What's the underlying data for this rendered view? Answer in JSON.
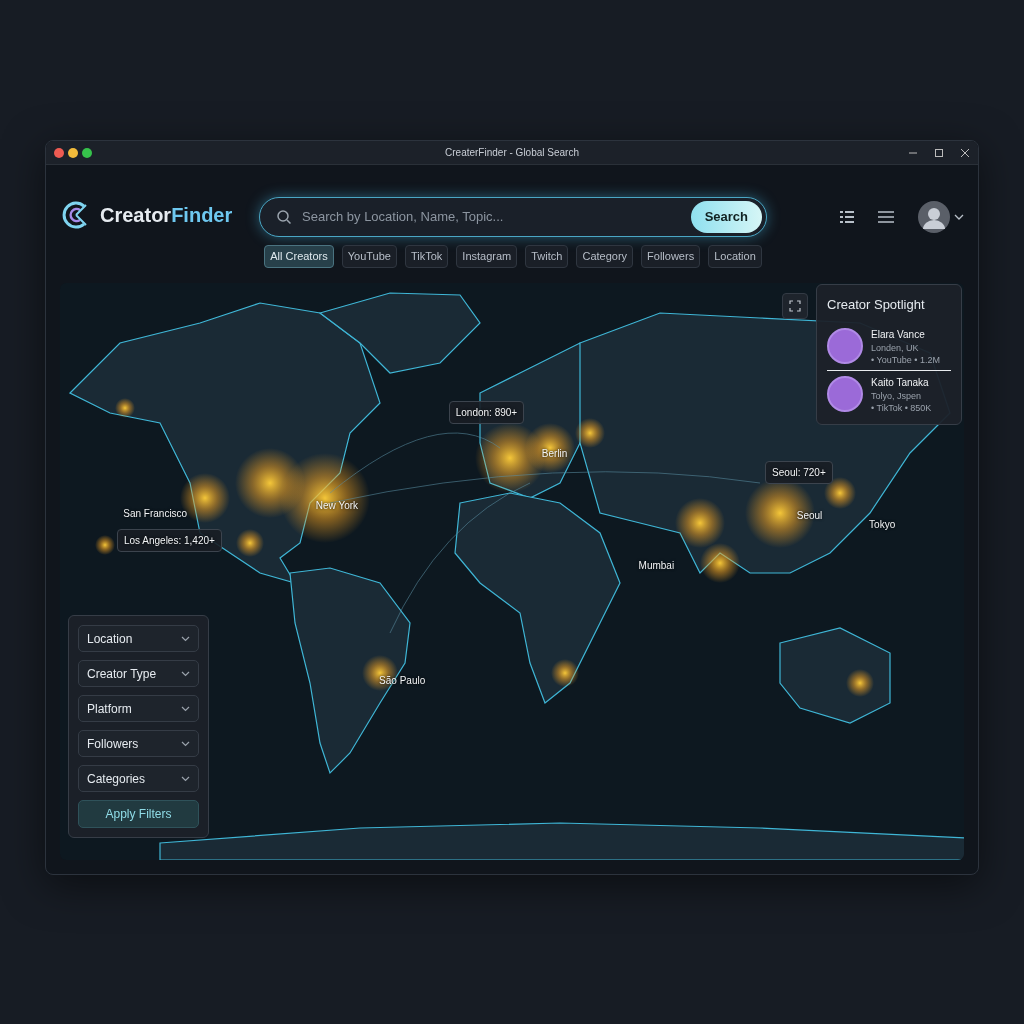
{
  "window": {
    "title": "CreaterFinder - Global Search"
  },
  "logo": {
    "part_1": "Creator",
    "part_2": "Finder"
  },
  "search": {
    "placeholder": "Search by Location, Name, Topic...",
    "button": "Search"
  },
  "filter_chips": [
    {
      "label": "All Creators",
      "selected": true
    },
    {
      "label": "YouTube",
      "selected": false
    },
    {
      "label": "TikTok",
      "selected": false
    },
    {
      "label": "Instagram",
      "selected": false
    },
    {
      "label": "Twitch",
      "selected": false
    },
    {
      "label": "Category",
      "selected": false
    },
    {
      "label": "Followers",
      "selected": false
    },
    {
      "label": "Location",
      "selected": false
    }
  ],
  "map_labels": [
    {
      "kind": "tooltip",
      "text": "London: 890+"
    },
    {
      "kind": "city",
      "text": "Berlin"
    },
    {
      "kind": "city",
      "text": "New York"
    },
    {
      "kind": "city",
      "text": "San Francisco"
    },
    {
      "kind": "tooltip",
      "text": "Los Angeles: 1,420+"
    },
    {
      "kind": "tooltip",
      "text": "Seoul: 720+"
    },
    {
      "kind": "city",
      "text": "Seoul"
    },
    {
      "kind": "city",
      "text": "Tokyo"
    },
    {
      "kind": "city",
      "text": "Mumbai"
    },
    {
      "kind": "city",
      "text": "São Paulo"
    }
  ],
  "spotlight": {
    "title": "Creator Spotlight",
    "creators": [
      {
        "name": "Elara Vance",
        "location": "Londen, UK",
        "meta": "• YouTube • 1.2M"
      },
      {
        "name": "Kaito Tanaka",
        "location": "Tolyo, Jspen",
        "meta": "• TikTok • 850K"
      }
    ]
  },
  "filters": [
    "Location",
    "Creator Type",
    "Platform",
    "Followers",
    "Categories"
  ],
  "apply_button": "Apply Filters"
}
